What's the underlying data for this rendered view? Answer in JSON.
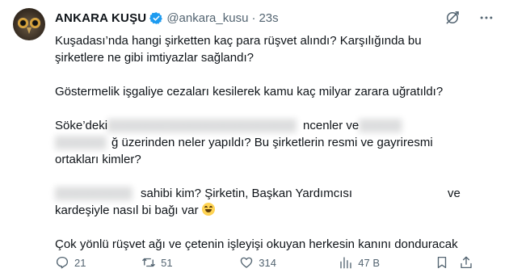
{
  "author": {
    "name": "ANKARA KUŞU",
    "handle": "@ankara_kusu",
    "separator": "·",
    "time": "23s",
    "verified": true,
    "verified_color": "#1d9bf0"
  },
  "tweet": {
    "p1_l1": "Kuşadası’nda hangi şirketten kaç para rüşvet alındı? Karşılığında bu",
    "p1_l2": "şirketlere ne gibi imtiyazlar sağlandı?",
    "p2": "Göstermelik işgaliye cezaları kesilerek kamu kaç milyar zarara uğratıldı?",
    "p3_l1_a": "Söke’deki",
    "p3_l1_b": "ncenler ve",
    "p3_l2": "ğ üzerinden neler yapıldı? Bu şirketlerin resmi ve gayriresmi",
    "p3_l3": "ortakları kimler?",
    "p4_l1_a": "sahibi kim? Şirketin, Başkan Yardımcısı",
    "p4_l1_b": "ve",
    "p4_l2": "kardeşiyle nasıl bi bağı var",
    "p5": "Çok yönlü rüşvet ağı ve çetenin işleyişi okuyan herkesin kanını donduracak"
  },
  "actions": {
    "replies": "21",
    "retweets": "51",
    "likes": "314",
    "views": "47 B"
  },
  "icons": {
    "reply": "reply-icon",
    "retweet": "retweet-icon",
    "like": "heart-icon",
    "views": "views-icon",
    "bookmark": "bookmark-icon",
    "share": "share-icon",
    "grok": "grok-icon",
    "more": "more-icon"
  }
}
